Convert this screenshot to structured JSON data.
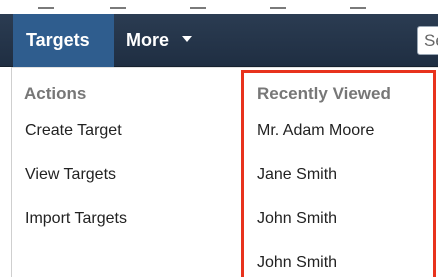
{
  "navbar": {
    "active_tab": "Targets",
    "more_tab": "More",
    "search_text": "Se"
  },
  "actions": {
    "heading": "Actions",
    "items": [
      "Create Target",
      "View Targets",
      "Import Targets"
    ]
  },
  "recently_viewed": {
    "heading": "Recently Viewed",
    "items": [
      "Mr. Adam Moore",
      "Jane Smith",
      "John Smith",
      "John Smith"
    ]
  },
  "colors": {
    "navbar_bg": "#243548",
    "active_tab_bg": "#2f5d8e",
    "highlight_outline": "#e8321c",
    "heading_text": "#777777"
  }
}
